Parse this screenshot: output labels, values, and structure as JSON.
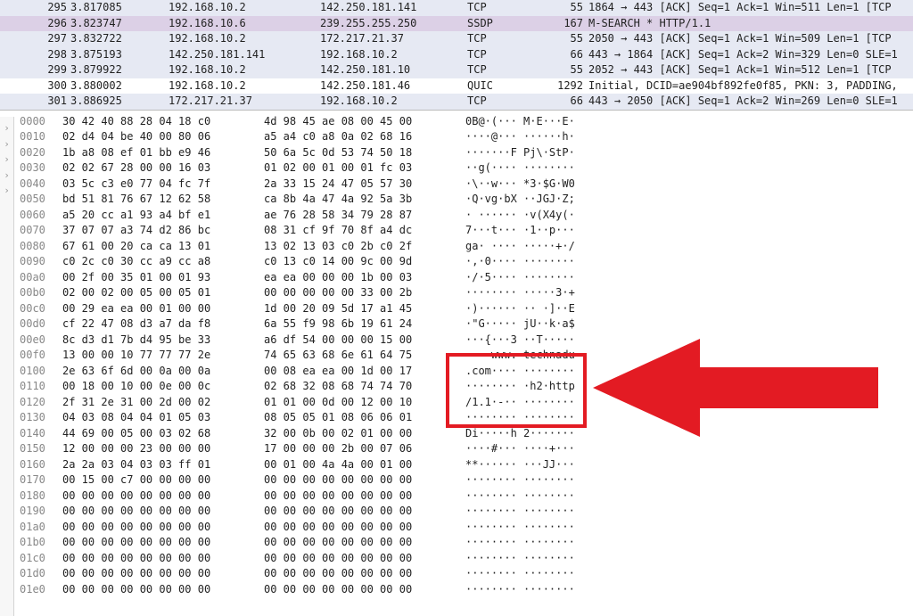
{
  "packets": [
    {
      "no": "295",
      "time": "3.817085",
      "src": "192.168.10.2",
      "dst": "142.250.181.141",
      "proto": "TCP",
      "len": "55",
      "info": "1864 → 443 [ACK] Seq=1 Ack=1 Win=511 Len=1 [TCP",
      "cls": "tcp"
    },
    {
      "no": "296",
      "time": "3.823747",
      "src": "192.168.10.6",
      "dst": "239.255.255.250",
      "proto": "SSDP",
      "len": "167",
      "info": "M-SEARCH * HTTP/1.1",
      "cls": "ssdp"
    },
    {
      "no": "297",
      "time": "3.832722",
      "src": "192.168.10.2",
      "dst": "172.217.21.37",
      "proto": "TCP",
      "len": "55",
      "info": "2050 → 443 [ACK] Seq=1 Ack=1 Win=509 Len=1 [TCP",
      "cls": "tcp"
    },
    {
      "no": "298",
      "time": "3.875193",
      "src": "142.250.181.141",
      "dst": "192.168.10.2",
      "proto": "TCP",
      "len": "66",
      "info": "443 → 1864 [ACK] Seq=1 Ack=2 Win=329 Len=0 SLE=1",
      "cls": "tcp"
    },
    {
      "no": "299",
      "time": "3.879922",
      "src": "192.168.10.2",
      "dst": "142.250.181.10",
      "proto": "TCP",
      "len": "55",
      "info": "2052 → 443 [ACK] Seq=1 Ack=1 Win=512 Len=1 [TCP",
      "cls": "tcp"
    },
    {
      "no": "300",
      "time": "3.880002",
      "src": "192.168.10.2",
      "dst": "142.250.181.46",
      "proto": "QUIC",
      "len": "1292",
      "info": "Initial, DCID=ae904bf892fe0f85, PKN: 3, PADDING,",
      "cls": "quic"
    },
    {
      "no": "301",
      "time": "3.886925",
      "src": "172.217.21.37",
      "dst": "192.168.10.2",
      "proto": "TCP",
      "len": "66",
      "info": "443 → 2050 [ACK] Seq=1 Ack=2 Win=269 Len=0 SLE=1",
      "cls": "tcp"
    }
  ],
  "hex": [
    {
      "off": "0000",
      "b1": "30 42 40 88 28 04 18 c0",
      "b2": "4d 98 45 ae 08 00 45 00",
      "a": "0B@·(··· M·E···E·"
    },
    {
      "off": "0010",
      "b1": "02 d4 04 be 40 00 80 06",
      "b2": "a5 a4 c0 a8 0a 02 68 16",
      "a": "····@··· ······h·"
    },
    {
      "off": "0020",
      "b1": "1b a8 08 ef 01 bb e9 46",
      "b2": "50 6a 5c 0d 53 74 50 18",
      "a": "·······F Pj\\·StP·"
    },
    {
      "off": "0030",
      "b1": "02 02 67 28 00 00 16 03",
      "b2": "01 02 00 01 00 01 fc 03",
      "a": "··g(···· ········"
    },
    {
      "off": "0040",
      "b1": "03 5c c3 e0 77 04 fc 7f",
      "b2": "2a 33 15 24 47 05 57 30",
      "a": "·\\··w··· *3·$G·W0"
    },
    {
      "off": "0050",
      "b1": "bd 51 81 76 67 12 62 58",
      "b2": "ca 8b 4a 47 4a 92 5a 3b",
      "a": "·Q·vg·bX ··JGJ·Z;"
    },
    {
      "off": "0060",
      "b1": "a5 20 cc a1 93 a4 bf e1",
      "b2": "ae 76 28 58 34 79 28 87",
      "a": "· ······ ·v(X4y(·"
    },
    {
      "off": "0070",
      "b1": "37 07 07 a3 74 d2 86 bc",
      "b2": "08 31 cf 9f 70 8f a4 dc",
      "a": "7···t··· ·1··p···"
    },
    {
      "off": "0080",
      "b1": "67 61 00 20 ca ca 13 01",
      "b2": "13 02 13 03 c0 2b c0 2f",
      "a": "ga· ···· ·····+·/"
    },
    {
      "off": "0090",
      "b1": "c0 2c c0 30 cc a9 cc a8",
      "b2": "c0 13 c0 14 00 9c 00 9d",
      "a": "·,·0···· ········"
    },
    {
      "off": "00a0",
      "b1": "00 2f 00 35 01 00 01 93",
      "b2": "ea ea 00 00 00 1b 00 03",
      "a": "·/·5···· ········"
    },
    {
      "off": "00b0",
      "b1": "02 00 02 00 05 00 05 01",
      "b2": "00 00 00 00 00 33 00 2b",
      "a": "········ ·····3·+"
    },
    {
      "off": "00c0",
      "b1": "00 29 ea ea 00 01 00 00",
      "b2": "1d 00 20 09 5d 17 a1 45",
      "a": "·)······ ·· ·]··E"
    },
    {
      "off": "00d0",
      "b1": "cf 22 47 08 d3 a7 da f8",
      "b2": "6a 55 f9 98 6b 19 61 24",
      "a": "·\"G····· jU··k·a$"
    },
    {
      "off": "00e0",
      "b1": "8c d3 d1 7b d4 95 be 33",
      "b2": "a6 df 54 00 00 00 15 00",
      "a": "···{···3 ··T·····"
    },
    {
      "off": "00f0",
      "b1": "13 00 00 10 77 77 77 2e",
      "b2": "74 65 63 68 6e 61 64 75",
      "a": "····www. technadu"
    },
    {
      "off": "0100",
      "b1": "2e 63 6f 6d 00 0a 00 0a",
      "b2": "00 08 ea ea 00 1d 00 17",
      "a": ".com···· ········"
    },
    {
      "off": "0110",
      "b1": "00 18 00 10 00 0e 00 0c",
      "b2": "02 68 32 08 68 74 74 70",
      "a": "········ ·h2·http"
    },
    {
      "off": "0120",
      "b1": "2f 31 2e 31 00 2d 00 02",
      "b2": "01 01 00 0d 00 12 00 10",
      "a": "/1.1·-·· ········"
    },
    {
      "off": "0130",
      "b1": "04 03 08 04 04 01 05 03",
      "b2": "08 05 05 01 08 06 06 01",
      "a": "········ ········"
    },
    {
      "off": "0140",
      "b1": "44 69 00 05 00 03 02 68",
      "b2": "32 00 0b 00 02 01 00 00",
      "a": "Di·····h 2·······"
    },
    {
      "off": "0150",
      "b1": "12 00 00 00 23 00 00 00",
      "b2": "17 00 00 00 2b 00 07 06",
      "a": "····#··· ····+···"
    },
    {
      "off": "0160",
      "b1": "2a 2a 03 04 03 03 ff 01",
      "b2": "00 01 00 4a 4a 00 01 00",
      "a": "**······ ···JJ···"
    },
    {
      "off": "0170",
      "b1": "00 15 00 c7 00 00 00 00",
      "b2": "00 00 00 00 00 00 00 00",
      "a": "········ ········"
    },
    {
      "off": "0180",
      "b1": "00 00 00 00 00 00 00 00",
      "b2": "00 00 00 00 00 00 00 00",
      "a": "········ ········"
    },
    {
      "off": "0190",
      "b1": "00 00 00 00 00 00 00 00",
      "b2": "00 00 00 00 00 00 00 00",
      "a": "········ ········"
    },
    {
      "off": "01a0",
      "b1": "00 00 00 00 00 00 00 00",
      "b2": "00 00 00 00 00 00 00 00",
      "a": "········ ········"
    },
    {
      "off": "01b0",
      "b1": "00 00 00 00 00 00 00 00",
      "b2": "00 00 00 00 00 00 00 00",
      "a": "········ ········"
    },
    {
      "off": "01c0",
      "b1": "00 00 00 00 00 00 00 00",
      "b2": "00 00 00 00 00 00 00 00",
      "a": "········ ········"
    },
    {
      "off": "01d0",
      "b1": "00 00 00 00 00 00 00 00",
      "b2": "00 00 00 00 00 00 00 00",
      "a": "········ ········"
    },
    {
      "off": "01e0",
      "b1": "00 00 00 00 00 00 00 00",
      "b2": "00 00 00 00 00 00 00 00",
      "a": "········ ········"
    }
  ],
  "annotation": {
    "highlighted_text": "www.technadu.com  h2·http/1.1",
    "arrow_target": "server-name-indication"
  }
}
